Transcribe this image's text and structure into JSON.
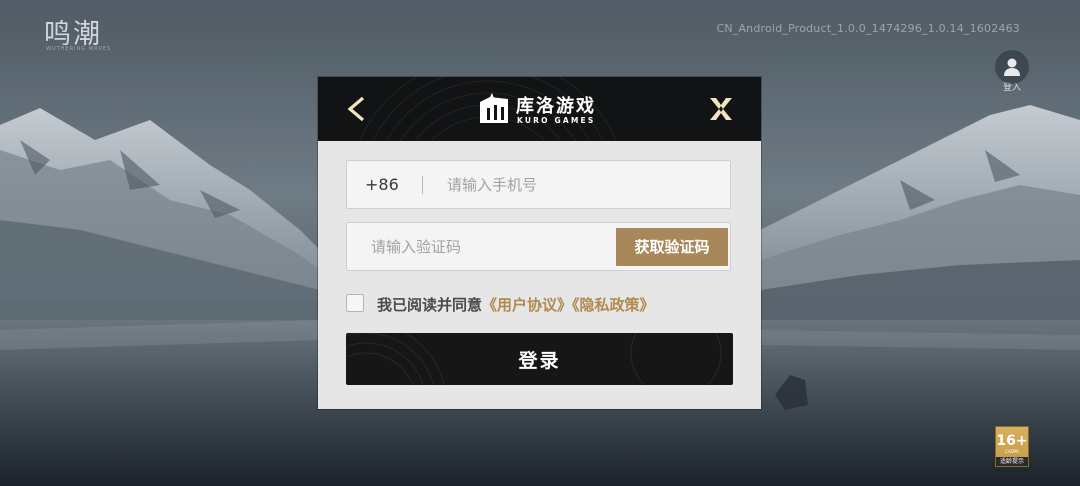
{
  "app": {
    "game_logo": "鸣潮",
    "game_logo_sub": "WUTHERING WAVES",
    "version": "CN_Android_Product_1.0.0_1474296_1.0.14_1602463",
    "account_label": "登入"
  },
  "age_rating": {
    "age": "16+",
    "org": "CADPA",
    "tip": "适龄提示",
    "color": "#c9a04e"
  },
  "dialog": {
    "brand_cn": "库洛游戏",
    "brand_en": "KURO GAMES",
    "back_icon": "chevron-left-icon",
    "close_icon": "close-x-icon",
    "phone": {
      "country_code": "+86",
      "placeholder": "请输入手机号",
      "value": ""
    },
    "code": {
      "placeholder": "请输入验证码",
      "value": "",
      "get_code_label": "获取验证码"
    },
    "agreement": {
      "prefix": "我已阅读并同意",
      "user_agreement": "《用户协议》",
      "privacy_policy": "《隐私政策》",
      "checked": false
    },
    "login_label": "登录",
    "colors": {
      "accent": "#a8875a",
      "link": "#b08a4e",
      "header_bg": "#121314",
      "login_bg": "#161616"
    }
  }
}
